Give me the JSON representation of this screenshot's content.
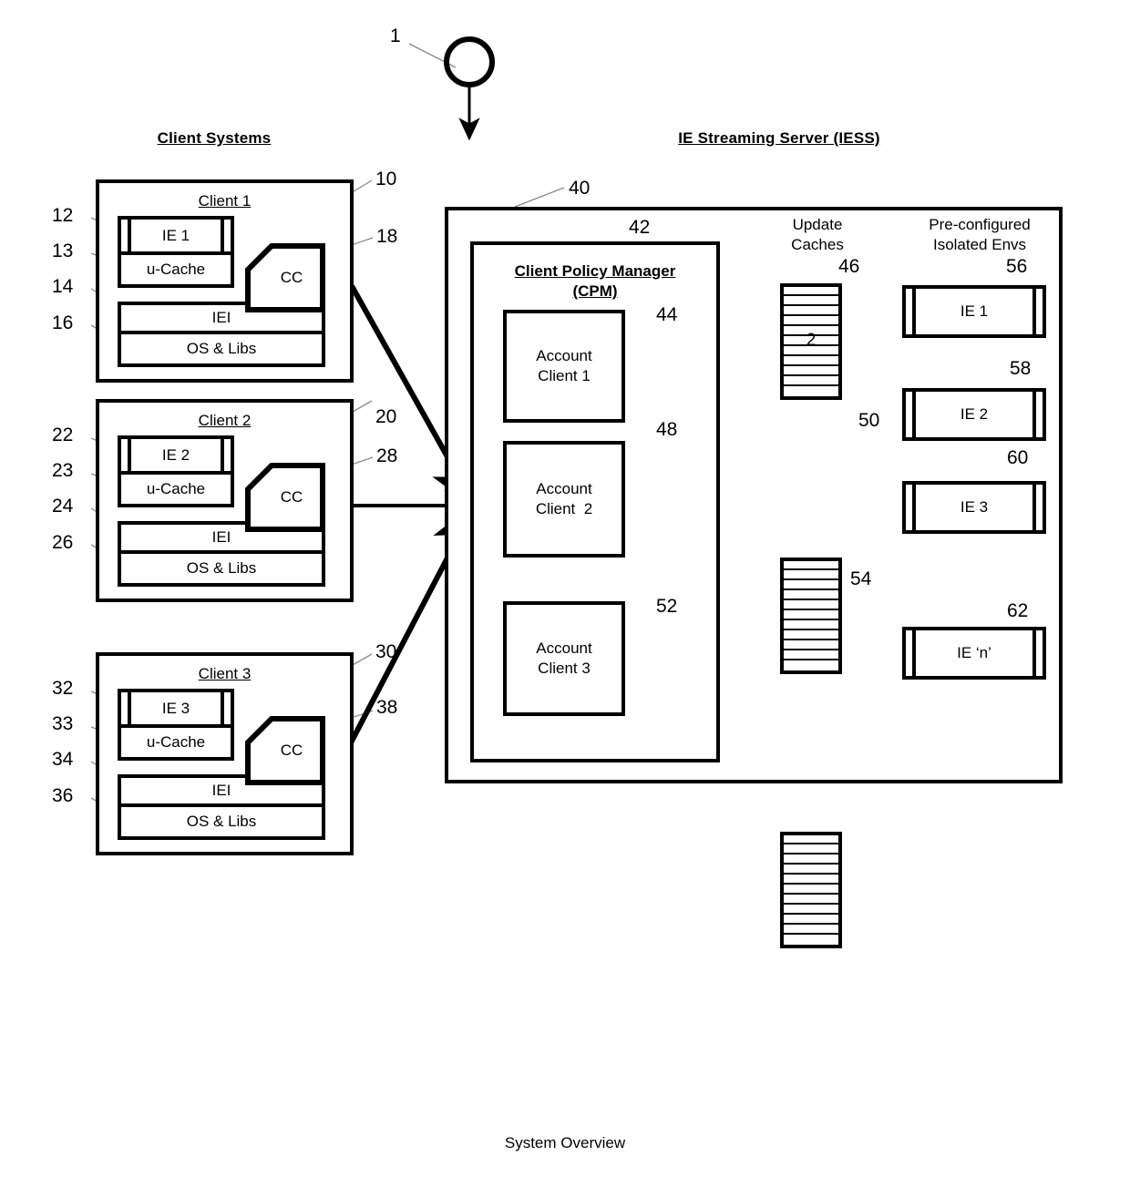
{
  "figure": {
    "caption": "System Overview",
    "system_ref": "1"
  },
  "headers": {
    "client_side": "Client Systems",
    "server_side": "IE Streaming Server (IESS)"
  },
  "client_systems": [
    {
      "title": "Client 1",
      "ie_label": "IE 1",
      "cache_label": "u-Cache",
      "iei_label": "IEI",
      "os_label": "OS & Libs",
      "cc_label": "CC",
      "refs": {
        "ie": "12",
        "ucache": "13",
        "iei": "14",
        "os": "16",
        "client": "10",
        "cc": "18"
      }
    },
    {
      "title": "Client 2",
      "ie_label": "IE 2",
      "cache_label": "u-Cache",
      "iei_label": "IEI",
      "os_label": "OS & Libs",
      "cc_label": "CC",
      "refs": {
        "ie": "22",
        "ucache": "23",
        "iei": "24",
        "os": "26",
        "client": "20",
        "cc": "28"
      }
    },
    {
      "title": "Client 3",
      "ie_label": "IE 3",
      "cache_label": "u-Cache",
      "iei_label": "IEI",
      "os_label": "OS & Libs",
      "cc_label": "CC",
      "refs": {
        "ie": "32",
        "ucache": "33",
        "iei": "34",
        "os": "36",
        "client": "30",
        "cc": "38"
      }
    }
  ],
  "server": {
    "ref": "40",
    "cpm": {
      "title_line1": "Client Policy Manager",
      "title_line2": "(CPM)",
      "ref": "42",
      "accounts": [
        {
          "label": "Account\nClient 1",
          "ref": "44"
        },
        {
          "label": "Account\nClient  2",
          "ref": "48"
        },
        {
          "label": "Account\nClient 3",
          "ref": "52"
        }
      ]
    },
    "update_caches": {
      "col_title_line1": "Update",
      "col_title_line2": "Caches",
      "items": [
        {
          "ref": "46",
          "value": "2"
        },
        {
          "ref": "50",
          "value": ""
        },
        {
          "ref": "54",
          "value": ""
        }
      ]
    },
    "isolated_envs": {
      "col_title_line1": "Pre-configured",
      "col_title_line2": "Isolated Envs",
      "items": [
        {
          "label": "IE 1",
          "ref": "56"
        },
        {
          "label": "IE 2",
          "ref": "58"
        },
        {
          "label": "IE 3",
          "ref": "60"
        },
        {
          "label": "IE ‘n’",
          "ref": "62"
        }
      ]
    }
  },
  "colors": {
    "ink": "#000000",
    "paper": "#ffffff",
    "leader": "#8a8a8a"
  }
}
